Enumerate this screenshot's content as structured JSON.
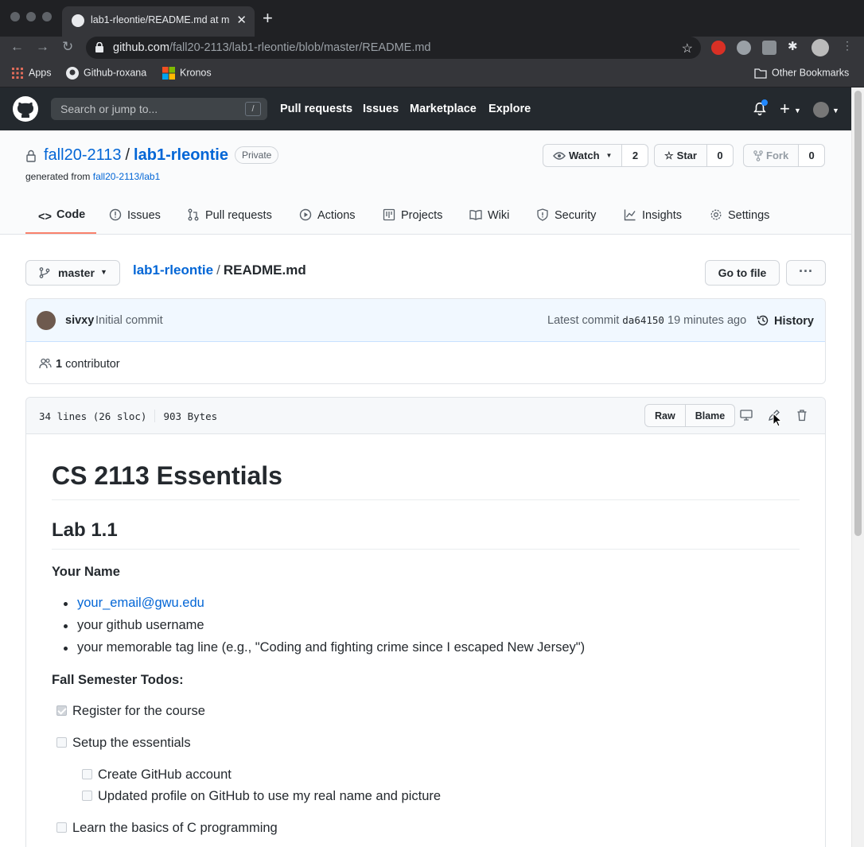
{
  "browser": {
    "tab_title": "lab1-rleontie/README.md at m",
    "url_domain": "github.com",
    "url_path": "/fall20-2113/lab1-rleontie/blob/master/README.md",
    "bookmarks": [
      "Apps",
      "Github-roxana",
      "Kronos"
    ],
    "other_bookmarks": "Other Bookmarks"
  },
  "gh_header": {
    "search_placeholder": "Search or jump to...",
    "search_key": "/",
    "nav": [
      "Pull requests",
      "Issues",
      "Marketplace",
      "Explore"
    ]
  },
  "repo": {
    "owner": "fall20-2113",
    "name": "lab1-rleontie",
    "visibility": "Private",
    "generated_from_label": "generated from",
    "generated_from_link": "fall20-2113/lab1",
    "watch": {
      "label": "Watch",
      "count": "2"
    },
    "star": {
      "label": "Star",
      "count": "0"
    },
    "fork": {
      "label": "Fork",
      "count": "0"
    },
    "tabs": [
      "Code",
      "Issues",
      "Pull requests",
      "Actions",
      "Projects",
      "Wiki",
      "Security",
      "Insights",
      "Settings"
    ]
  },
  "file_nav": {
    "branch": "master",
    "repo_link": "lab1-rleontie",
    "separator": "/",
    "file_name": "README.md",
    "goto_file": "Go to file",
    "more": "···"
  },
  "commit": {
    "author": "sivxy",
    "message": "Initial commit",
    "latest_label": "Latest commit",
    "sha": "da64150",
    "time": "19 minutes ago",
    "history": "History",
    "contributors_count": "1",
    "contributors_label": "contributor"
  },
  "file": {
    "lines": "34 lines (26 sloc)",
    "size": "903 Bytes",
    "raw": "Raw",
    "blame": "Blame"
  },
  "readme": {
    "h1": "CS 2113 Essentials",
    "h2": "Lab 1.1",
    "name_heading": "Your Name",
    "name_items": [
      "your_email@gwu.edu",
      "your github username",
      "your memorable tag line (e.g., \"Coding and fighting crime since I escaped New Jersey\")"
    ],
    "todos_heading": "Fall Semester Todos:",
    "tasks": [
      {
        "label": "Register for the course",
        "checked": true
      },
      {
        "label": "Setup the essentials",
        "checked": false
      },
      {
        "label": "Create GitHub account",
        "checked": false
      },
      {
        "label": "Updated profile on GitHub to use my real name and picture",
        "checked": false
      },
      {
        "label": "Learn the basics of C programming",
        "checked": false
      }
    ]
  },
  "colors": {
    "link": "#0366d6",
    "header_bg": "#24292e",
    "tab_underline": "#f9826c",
    "commit_bg": "#f1f8ff"
  }
}
